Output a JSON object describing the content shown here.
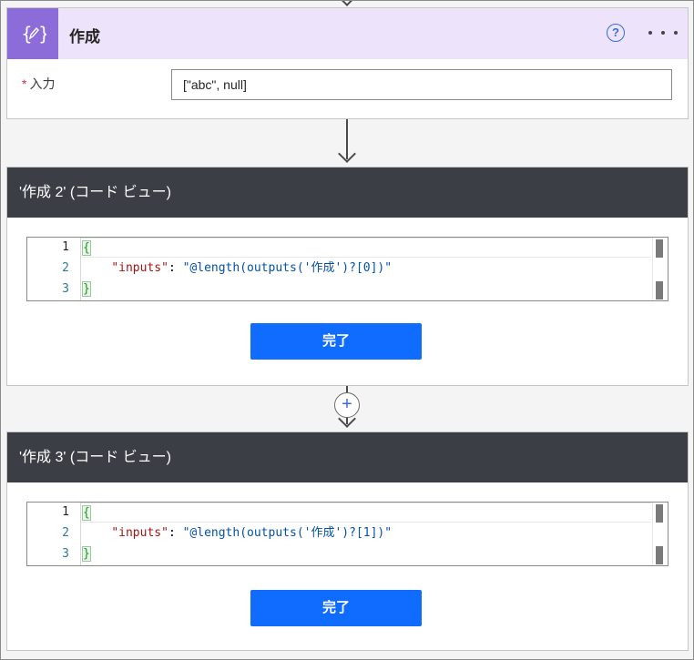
{
  "compose_card": {
    "title": "作成",
    "help_label": "?",
    "field_label": "入力",
    "required_mark": "*",
    "field_value": "[\"abc\", null]"
  },
  "code_cards": [
    {
      "title": "'作成 2' (コード ビュー)",
      "lines": [
        {
          "num": "1",
          "text": "{"
        },
        {
          "num": "2",
          "key": "\"inputs\"",
          "sep": ": ",
          "value": "\"@length(outputs('作成')?[0])\""
        },
        {
          "num": "3",
          "text": "}"
        }
      ],
      "done_label": "完了"
    },
    {
      "title": "'作成 3' (コード ビュー)",
      "lines": [
        {
          "num": "1",
          "text": "{"
        },
        {
          "num": "2",
          "key": "\"inputs\"",
          "sep": ": ",
          "value": "\"@length(outputs('作成')?[1])\""
        },
        {
          "num": "3",
          "text": "}"
        }
      ],
      "done_label": "完了"
    }
  ],
  "add_step_label": "+",
  "icons": {
    "compose": "compose-icon",
    "help": "help-icon",
    "more": "more-options-icon",
    "add": "add-step-icon",
    "arrow": "arrow-down-icon"
  },
  "colors": {
    "compose_accent": "#8c6cd8",
    "compose_header_bg": "#ede3fb",
    "code_header_bg": "#3b3f45",
    "button_blue": "#0f6cff",
    "required_red": "#c4314b"
  }
}
